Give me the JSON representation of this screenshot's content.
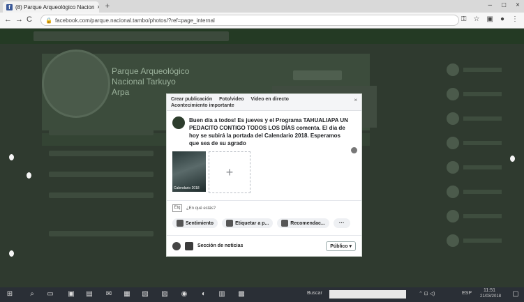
{
  "browser": {
    "tab_title": "(8) Parque Arqueológico Nacion",
    "tab_close": "×",
    "new_tab": "+",
    "url": "facebook.com/parque.nacional.tambo/photos/?ref=page_internal",
    "window_buttons": [
      "–",
      "□",
      "×"
    ]
  },
  "facebook": {
    "page_name_line1": "Parque Arqueológico",
    "page_name_line2": "Nacional Tarkuyo",
    "page_name_line3": "Arpa"
  },
  "modal": {
    "tabs": [
      "Crear publicación",
      "Foto/video",
      "Video en directo",
      "Acontecimiento importante"
    ],
    "close": "×",
    "post_text": "Buen día a todos! Es jueves y el Programa TAHUALIAPA UN PEDACITO CONTIGO TODOS LOS DÍAS comenta. El día de hoy se subirá la portada del Calendario 2018. Esperamos que sea de su agrado",
    "thumb_caption": "Calendario 2018",
    "add_more": "+",
    "tag_label": "¿En qué estás?",
    "tag_box": "Etq",
    "actions": [
      "Sentimiento",
      "Etiquetar a p...",
      "Recomendac..."
    ],
    "more": "···",
    "footer_feed": "Sección de noticias",
    "footer_public": "Público ▾"
  },
  "taskbar": {
    "start": "⊞",
    "search_label": "Buscar",
    "time": "11:51",
    "date": "21/03/2018",
    "lang": "ESP"
  }
}
